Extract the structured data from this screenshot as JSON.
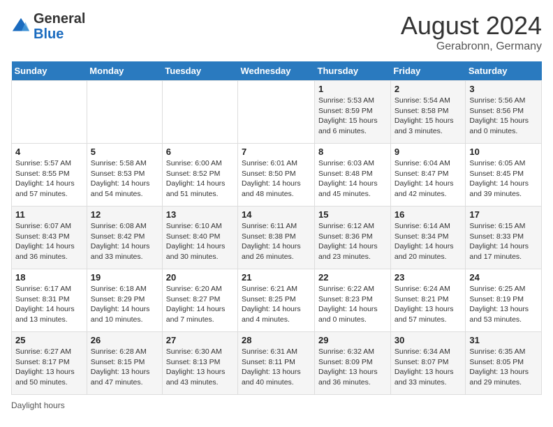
{
  "header": {
    "logo_line1": "General",
    "logo_line2": "Blue",
    "month": "August 2024",
    "location": "Gerabronn, Germany"
  },
  "days_of_week": [
    "Sunday",
    "Monday",
    "Tuesday",
    "Wednesday",
    "Thursday",
    "Friday",
    "Saturday"
  ],
  "weeks": [
    [
      {
        "day": "",
        "detail": ""
      },
      {
        "day": "",
        "detail": ""
      },
      {
        "day": "",
        "detail": ""
      },
      {
        "day": "",
        "detail": ""
      },
      {
        "day": "1",
        "detail": "Sunrise: 5:53 AM\nSunset: 8:59 PM\nDaylight: 15 hours\nand 6 minutes."
      },
      {
        "day": "2",
        "detail": "Sunrise: 5:54 AM\nSunset: 8:58 PM\nDaylight: 15 hours\nand 3 minutes."
      },
      {
        "day": "3",
        "detail": "Sunrise: 5:56 AM\nSunset: 8:56 PM\nDaylight: 15 hours\nand 0 minutes."
      }
    ],
    [
      {
        "day": "4",
        "detail": "Sunrise: 5:57 AM\nSunset: 8:55 PM\nDaylight: 14 hours\nand 57 minutes."
      },
      {
        "day": "5",
        "detail": "Sunrise: 5:58 AM\nSunset: 8:53 PM\nDaylight: 14 hours\nand 54 minutes."
      },
      {
        "day": "6",
        "detail": "Sunrise: 6:00 AM\nSunset: 8:52 PM\nDaylight: 14 hours\nand 51 minutes."
      },
      {
        "day": "7",
        "detail": "Sunrise: 6:01 AM\nSunset: 8:50 PM\nDaylight: 14 hours\nand 48 minutes."
      },
      {
        "day": "8",
        "detail": "Sunrise: 6:03 AM\nSunset: 8:48 PM\nDaylight: 14 hours\nand 45 minutes."
      },
      {
        "day": "9",
        "detail": "Sunrise: 6:04 AM\nSunset: 8:47 PM\nDaylight: 14 hours\nand 42 minutes."
      },
      {
        "day": "10",
        "detail": "Sunrise: 6:05 AM\nSunset: 8:45 PM\nDaylight: 14 hours\nand 39 minutes."
      }
    ],
    [
      {
        "day": "11",
        "detail": "Sunrise: 6:07 AM\nSunset: 8:43 PM\nDaylight: 14 hours\nand 36 minutes."
      },
      {
        "day": "12",
        "detail": "Sunrise: 6:08 AM\nSunset: 8:42 PM\nDaylight: 14 hours\nand 33 minutes."
      },
      {
        "day": "13",
        "detail": "Sunrise: 6:10 AM\nSunset: 8:40 PM\nDaylight: 14 hours\nand 30 minutes."
      },
      {
        "day": "14",
        "detail": "Sunrise: 6:11 AM\nSunset: 8:38 PM\nDaylight: 14 hours\nand 26 minutes."
      },
      {
        "day": "15",
        "detail": "Sunrise: 6:12 AM\nSunset: 8:36 PM\nDaylight: 14 hours\nand 23 minutes."
      },
      {
        "day": "16",
        "detail": "Sunrise: 6:14 AM\nSunset: 8:34 PM\nDaylight: 14 hours\nand 20 minutes."
      },
      {
        "day": "17",
        "detail": "Sunrise: 6:15 AM\nSunset: 8:33 PM\nDaylight: 14 hours\nand 17 minutes."
      }
    ],
    [
      {
        "day": "18",
        "detail": "Sunrise: 6:17 AM\nSunset: 8:31 PM\nDaylight: 14 hours\nand 13 minutes."
      },
      {
        "day": "19",
        "detail": "Sunrise: 6:18 AM\nSunset: 8:29 PM\nDaylight: 14 hours\nand 10 minutes."
      },
      {
        "day": "20",
        "detail": "Sunrise: 6:20 AM\nSunset: 8:27 PM\nDaylight: 14 hours\nand 7 minutes."
      },
      {
        "day": "21",
        "detail": "Sunrise: 6:21 AM\nSunset: 8:25 PM\nDaylight: 14 hours\nand 4 minutes."
      },
      {
        "day": "22",
        "detail": "Sunrise: 6:22 AM\nSunset: 8:23 PM\nDaylight: 14 hours\nand 0 minutes."
      },
      {
        "day": "23",
        "detail": "Sunrise: 6:24 AM\nSunset: 8:21 PM\nDaylight: 13 hours\nand 57 minutes."
      },
      {
        "day": "24",
        "detail": "Sunrise: 6:25 AM\nSunset: 8:19 PM\nDaylight: 13 hours\nand 53 minutes."
      }
    ],
    [
      {
        "day": "25",
        "detail": "Sunrise: 6:27 AM\nSunset: 8:17 PM\nDaylight: 13 hours\nand 50 minutes."
      },
      {
        "day": "26",
        "detail": "Sunrise: 6:28 AM\nSunset: 8:15 PM\nDaylight: 13 hours\nand 47 minutes."
      },
      {
        "day": "27",
        "detail": "Sunrise: 6:30 AM\nSunset: 8:13 PM\nDaylight: 13 hours\nand 43 minutes."
      },
      {
        "day": "28",
        "detail": "Sunrise: 6:31 AM\nSunset: 8:11 PM\nDaylight: 13 hours\nand 40 minutes."
      },
      {
        "day": "29",
        "detail": "Sunrise: 6:32 AM\nSunset: 8:09 PM\nDaylight: 13 hours\nand 36 minutes."
      },
      {
        "day": "30",
        "detail": "Sunrise: 6:34 AM\nSunset: 8:07 PM\nDaylight: 13 hours\nand 33 minutes."
      },
      {
        "day": "31",
        "detail": "Sunrise: 6:35 AM\nSunset: 8:05 PM\nDaylight: 13 hours\nand 29 minutes."
      }
    ]
  ],
  "footer": {
    "label": "Daylight hours"
  }
}
